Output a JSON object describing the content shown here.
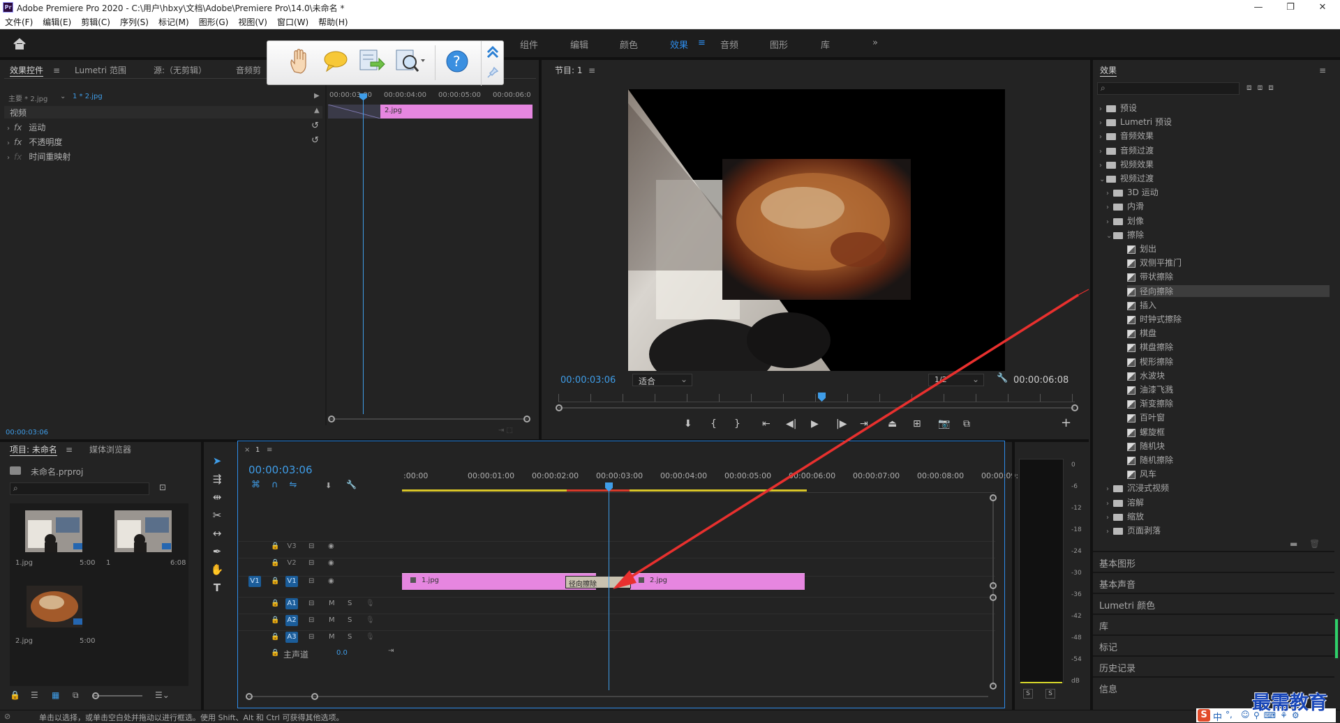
{
  "app": {
    "title": "Adobe Premiere Pro 2020 - C:\\用户\\hbxy\\文档\\Adobe\\Premiere Pro\\14.0\\未命名 *",
    "logo_text": "Pr"
  },
  "window_controls": {
    "minimize": "—",
    "restore": "❐",
    "close": "✕"
  },
  "menu": [
    "文件(F)",
    "编辑(E)",
    "剪辑(C)",
    "序列(S)",
    "标记(M)",
    "图形(G)",
    "视图(V)",
    "窗口(W)",
    "帮助(H)"
  ],
  "workspaces": {
    "items": [
      "组件",
      "编辑",
      "颜色",
      "效果",
      "音频",
      "图形",
      "库"
    ],
    "active": "效果",
    "more": "»"
  },
  "effect_controls": {
    "tabs": [
      "效果控件",
      "Lumetri 范围",
      "源:（无剪辑）",
      "音频剪"
    ],
    "master": "主要 * 2.jpg",
    "clip": "1 * 2.jpg",
    "section": "视频",
    "rows": [
      "运动",
      "不透明度",
      "时间重映射"
    ],
    "fx_glyph": "fx",
    "ruler": [
      "00:00:03:00",
      "00:00:04:00",
      "00:00:05:00",
      "00:00:06:0"
    ],
    "clip_label": "2.jpg",
    "timecode": "00:00:03:06"
  },
  "program": {
    "title": "节目: 1",
    "timecode": "00:00:03:06",
    "fit": "适合",
    "resolution": "1/2",
    "duration": "00:00:06:08"
  },
  "effects_panel": {
    "title": "效果",
    "search_placeholder": "",
    "top": [
      {
        "label": "预设",
        "open": false
      },
      {
        "label": "Lumetri 预设",
        "open": false
      },
      {
        "label": "音频效果",
        "open": false
      },
      {
        "label": "音频过渡",
        "open": false
      },
      {
        "label": "视频效果",
        "open": false
      },
      {
        "label": "视频过渡",
        "open": true
      }
    ],
    "transitions": [
      {
        "label": "3D 运动",
        "open": false
      },
      {
        "label": "内滑",
        "open": false
      },
      {
        "label": "划像",
        "open": false
      },
      {
        "label": "擦除",
        "open": true
      }
    ],
    "wipes": [
      "划出",
      "双侧平推门",
      "带状擦除",
      "径向擦除",
      "插入",
      "时钟式擦除",
      "棋盘",
      "棋盘擦除",
      "楔形擦除",
      "水波块",
      "油漆飞溅",
      "渐变擦除",
      "百叶窗",
      "螺旋框",
      "随机块",
      "随机擦除",
      "风车"
    ],
    "selected": "径向擦除",
    "after": [
      "沉浸式视频",
      "溶解",
      "缩放",
      "页面剥落"
    ],
    "collapsed": [
      "基本图形",
      "基本声音",
      "Lumetri 颜色",
      "库",
      "标记",
      "历史记录",
      "信息"
    ]
  },
  "project": {
    "tabs": [
      "项目: 未命名",
      "媒体浏览器"
    ],
    "file": "未命名.prproj",
    "items": [
      {
        "name": "1.jpg",
        "dur": "5:00"
      },
      {
        "name": "1",
        "dur": "6:08"
      },
      {
        "name": "2.jpg",
        "dur": "5:00"
      }
    ]
  },
  "timeline": {
    "tab": "1",
    "timecode": "00:00:03:06",
    "ruler": [
      ":00:00",
      "00:00:01:00",
      "00:00:02:00",
      "00:00:03:00",
      "00:00:04:00",
      "00:00:05:00",
      "00:00:06:00",
      "00:00:07:00",
      "00:00:08:00",
      "00:00:09:"
    ],
    "video_tracks": [
      "V3",
      "V2",
      "V1"
    ],
    "audio_tracks": [
      "A1",
      "A2",
      "A3"
    ],
    "source_patch": "V1",
    "master_label": "主声道",
    "master_value": "0.0",
    "clip1": "1.jpg",
    "clip2": "2.jpg",
    "transition": "径向擦除",
    "m": "M",
    "s": "S"
  },
  "meter": {
    "labels": [
      "0",
      "-6",
      "-12",
      "-18",
      "-24",
      "-30",
      "-36",
      "-42",
      "-48",
      "-54",
      "dB"
    ],
    "solo": [
      "S",
      "S"
    ]
  },
  "status": "单击以选择，或单击空白处并拖动以进行框选。使用 Shift、Alt 和 Ctrl 可获得其他选项。",
  "watermark": "最需教育",
  "ime": [
    "中",
    "°,",
    "☺"
  ],
  "colors": {
    "accent": "#2d8ceb",
    "clip": "#e686e0",
    "arrow": "#e8302e",
    "playhead": "#3f9de8"
  }
}
